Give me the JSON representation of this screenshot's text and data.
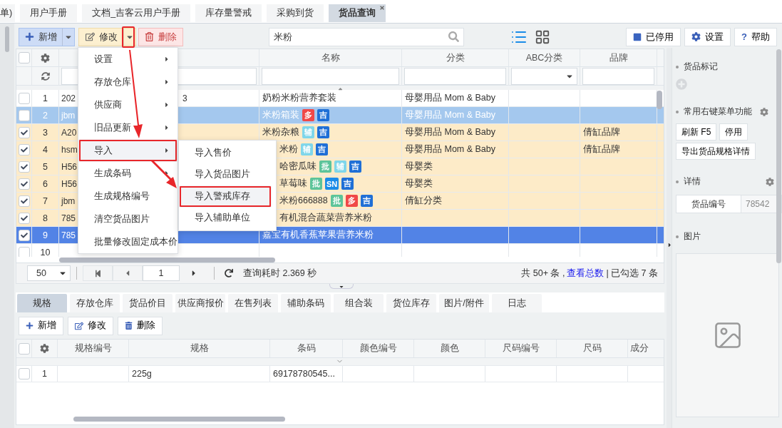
{
  "top_tabs": [
    {
      "label": "单)",
      "selected": false,
      "closable": false
    },
    {
      "label": "用户手册",
      "selected": false,
      "closable": false
    },
    {
      "label": "文档_吉客云用户手册",
      "selected": false,
      "closable": false
    },
    {
      "label": "库存量警戒",
      "selected": false,
      "closable": false
    },
    {
      "label": "采购到货",
      "selected": false,
      "closable": false
    },
    {
      "label": "货品查询",
      "selected": true,
      "closable": true
    }
  ],
  "toolbar": {
    "add": "新增",
    "edit": "修改",
    "delete": "删除",
    "search": {
      "value": "米粉"
    },
    "view_buttons": [
      {
        "kind": "list",
        "selected": true
      },
      {
        "kind": "grid",
        "selected": false
      }
    ],
    "right_buttons": [
      {
        "label": "已停用",
        "kind": "square"
      },
      {
        "label": "设置",
        "kind": "gear"
      },
      {
        "label": "帮助",
        "kind": "help",
        "icon": "?"
      }
    ]
  },
  "grid": {
    "all_checked": false,
    "columns": [
      "名称",
      "分类",
      "ABC分类",
      "品牌"
    ],
    "rows": [
      {
        "number": "1",
        "checked": false,
        "selected": false,
        "hovered": false,
        "code": "202",
        "code_tail": "3",
        "name": "奶粉米粉营养套装",
        "category": "母婴用品 Mom & Baby"
      },
      {
        "number": "2",
        "checked": false,
        "selected": false,
        "hovered": true,
        "code": "jbm",
        "name": "米粉箱装",
        "tags": [
          {
            "label": "多",
            "color": "#f04848"
          },
          {
            "label": "吉",
            "color": "#1f6fd6"
          }
        ],
        "category": "母婴用品 Mom & Baby"
      },
      {
        "number": "3",
        "checked": true,
        "selected": false,
        "hovered": false,
        "code": "A20",
        "name": "米粉杂粮",
        "tags": [
          {
            "label": "辅",
            "color": "#7fd6ea"
          },
          {
            "label": "吉",
            "color": "#1f6fd6"
          }
        ],
        "category": "母婴用品 Mom & Baby",
        "brand": "倩缸品牌"
      },
      {
        "number": "4",
        "checked": true,
        "selected": false,
        "hovered": false,
        "code": "hsm",
        "name": "米粉",
        "covered": true,
        "tags": [
          {
            "label": "辅",
            "color": "#7fd6ea"
          },
          {
            "label": "吉",
            "color": "#1f6fd6"
          }
        ],
        "category": "母婴用品 Mom & Baby",
        "brand": "倩缸品牌"
      },
      {
        "number": "5",
        "checked": true,
        "selected": false,
        "hovered": false,
        "code": "H56",
        "name": "哈密瓜味",
        "covered": true,
        "tags": [
          {
            "label": "批",
            "color": "#5cc49a"
          },
          {
            "label": "辅",
            "color": "#7fd6ea"
          },
          {
            "label": "吉",
            "color": "#1f6fd6"
          }
        ],
        "category": "母婴类"
      },
      {
        "number": "6",
        "checked": true,
        "selected": false,
        "hovered": false,
        "code": "H56",
        "name": "草莓味",
        "covered": true,
        "tags": [
          {
            "label": "批",
            "color": "#5cc49a"
          },
          {
            "label": "SN",
            "color": "#1a8ce8"
          },
          {
            "label": "吉",
            "color": "#1f6fd6"
          }
        ],
        "category": "母婴类"
      },
      {
        "number": "7",
        "checked": true,
        "selected": false,
        "hovered": false,
        "code": "jbm",
        "name": "米粉666888",
        "covered": true,
        "tags": [
          {
            "label": "批",
            "color": "#5cc49a"
          },
          {
            "label": "多",
            "color": "#f04848"
          },
          {
            "label": "吉",
            "color": "#1f6fd6"
          }
        ],
        "category": "倩缸分类"
      },
      {
        "number": "8",
        "checked": true,
        "selected": false,
        "hovered": false,
        "code": "785",
        "name": "有机混合蔬菜营养米粉",
        "covered": true
      },
      {
        "number": "9",
        "checked": true,
        "selected": true,
        "hovered": false,
        "code": "785",
        "name": "嘉宝有机香蕉苹果营养米粉"
      },
      {
        "number": "10",
        "checked": false,
        "selected": false,
        "hovered": false
      }
    ]
  },
  "menu": [
    {
      "label": "设置",
      "has_submenu": true,
      "selected": false
    },
    {
      "label": "存放仓库",
      "has_submenu": true,
      "selected": false
    },
    {
      "label": "供应商",
      "has_submenu": true,
      "selected": false
    },
    {
      "label": "旧品更新",
      "has_submenu": true,
      "selected": false
    },
    {
      "label": "导入",
      "has_submenu": true,
      "selected": true
    },
    {
      "label": "生成条码",
      "has_submenu": true,
      "selected": false
    },
    {
      "label": "生成规格编号",
      "has_submenu": false,
      "selected": false
    },
    {
      "label": "清空货品图片",
      "has_submenu": false,
      "selected": false
    },
    {
      "label": "批量修改固定成本价",
      "has_submenu": false,
      "selected": false
    }
  ],
  "submenu": [
    {
      "label": "导入售价",
      "selected": false
    },
    {
      "label": "导入货品图片",
      "selected": false
    },
    {
      "label": "导入警戒库存",
      "selected": true
    },
    {
      "label": "导入辅助单位",
      "selected": false
    }
  ],
  "pager": {
    "page_size": "50",
    "page": "1",
    "query_time": "查询耗时 2.369 秒",
    "total_prefix": "共 50+ 条 ,",
    "total_link": "查看总数",
    "selected_count": "| 已勾选 7 条"
  },
  "detail_tabs": [
    {
      "label": "规格",
      "selected": true
    },
    {
      "label": "存放仓库",
      "selected": false
    },
    {
      "label": "货品价目",
      "selected": false
    },
    {
      "label": "供应商报价",
      "selected": false
    },
    {
      "label": "在售列表",
      "selected": false
    },
    {
      "label": "辅助条码",
      "selected": false
    },
    {
      "label": "组合装",
      "selected": false
    },
    {
      "label": "货位库存",
      "selected": false
    },
    {
      "label": "图片/附件",
      "selected": false
    },
    {
      "label": "日志",
      "selected": false
    }
  ],
  "detail_toolbar": [
    "新增",
    "修改",
    "删除"
  ],
  "spec_grid": {
    "all_checked": false,
    "columns": [
      "规格编号",
      "规格",
      "条码",
      "颜色编号",
      "颜色",
      "尺码编号",
      "尺码",
      "成分"
    ],
    "rows": [
      {
        "number": "1",
        "checked": false,
        "cells": [
          "",
          "225g",
          "69178780545...",
          "",
          "",
          "",
          "",
          ""
        ]
      }
    ]
  },
  "side_panel": {
    "mark_title": "货品标记",
    "menu_title": "常用右键菜单功能",
    "menu_buttons": [
      "刷新 F5",
      "停用",
      "导出货品规格详情"
    ],
    "detail_title": "详情",
    "detail_label": "货品编号",
    "detail_value": "78542",
    "image_title": "图片"
  }
}
